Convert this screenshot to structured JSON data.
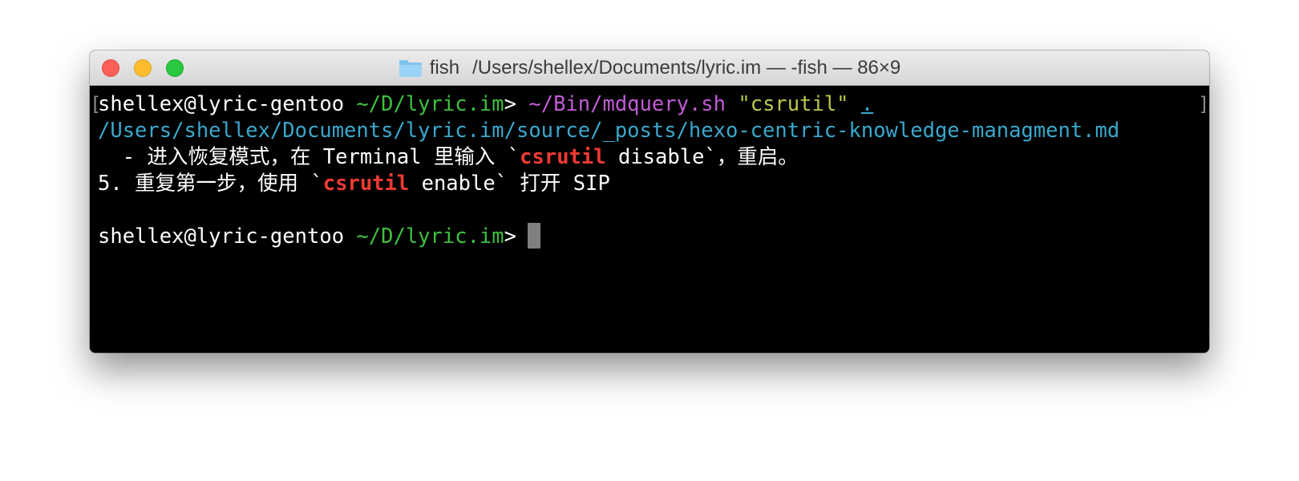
{
  "window": {
    "title_app": "fish",
    "title_path": "/Users/shellex/Documents/lyric.im — -fish — 86×9",
    "folder_icon": "folder-icon",
    "close_color": "#fc5f57",
    "minimize_color": "#fdbc2e",
    "zoom_color": "#28c840"
  },
  "terminal": {
    "line1": {
      "user_host": "shellex@lyric-gentoo",
      "cwd": "~/D/lyric.im",
      "prompt_symbol": ">",
      "command": "~/Bin/mdquery.sh",
      "argument": "\"csrutil\"",
      "path_arg": "."
    },
    "line2": {
      "result_path": "/Users/shellex/Documents/lyric.im/source/_posts/hexo-centric-knowledge-managment.md"
    },
    "line3": {
      "before": "  - 进入恢复模式，在 Terminal 里输入 `",
      "match": "csrutil",
      "after": " disable`，重启。"
    },
    "line4": {
      "before": "5. 重复第一步，使用 `",
      "match": "csrutil",
      "after": " enable` 打开 SIP"
    },
    "line6": {
      "user_host": "shellex@lyric-gentoo",
      "cwd": "~/D/lyric.im",
      "prompt_symbol": ">"
    },
    "colors": {
      "background": "#000000",
      "cwd": "#3cc13c",
      "command": "#c25bd6",
      "string": "#bcc54a",
      "path": "#39a8cd",
      "match": "#ee3a33"
    }
  }
}
